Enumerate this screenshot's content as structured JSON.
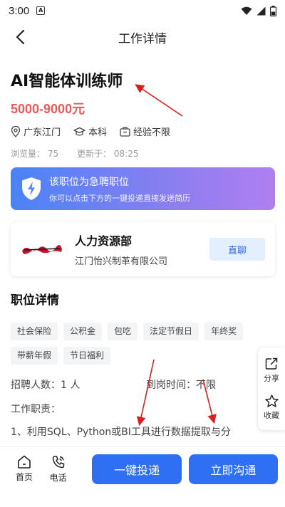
{
  "status_bar": {
    "time": "3:00",
    "notif_glyph": "A"
  },
  "nav": {
    "title": "工作详情"
  },
  "job": {
    "title": "AI智能体训练师",
    "salary": "5000-9000元",
    "location": "广东江门",
    "education": "本科",
    "experience": "经验不限",
    "views": "浏览量： 75",
    "updated": "更新于： 08:25"
  },
  "banner": {
    "title": "该职位为急聘职位",
    "subtitle": "你可以点击下方的一键投递直接发送简历"
  },
  "company": {
    "department": "人力资源部",
    "name": "江门怡兴制革有限公司",
    "chat_label": "直聊"
  },
  "details": {
    "section_title": "职位详情",
    "tags": [
      "社会保险",
      "公积金",
      "包吃",
      "法定节假日",
      "年终奖",
      "带薪年假",
      "节日福利"
    ],
    "recruit_count": "招聘人数：1 人",
    "arrival_time": "到岗时间：不限",
    "duty_label": "工作职责：",
    "duty_line1": "1、利用SQL、Python或BI工具进行数据提取与分"
  },
  "side_panel": {
    "share_label": "分享",
    "favorite_label": "收藏"
  },
  "bottom_bar": {
    "home_label": "首页",
    "phone_label": "电话",
    "apply_label": "一键投递",
    "chat_label": "立即沟通"
  },
  "colors": {
    "primary": "#2f6ff2",
    "salary": "#ea5a5a",
    "annotation": "#d81e1e"
  },
  "icons": [
    "back-arrow-icon",
    "location-pin-icon",
    "graduation-cap-icon",
    "briefcase-icon",
    "shield-lightning-icon",
    "share-icon",
    "star-icon",
    "home-icon",
    "phone-icon",
    "wifi-icon",
    "signal-icon",
    "battery-icon"
  ]
}
